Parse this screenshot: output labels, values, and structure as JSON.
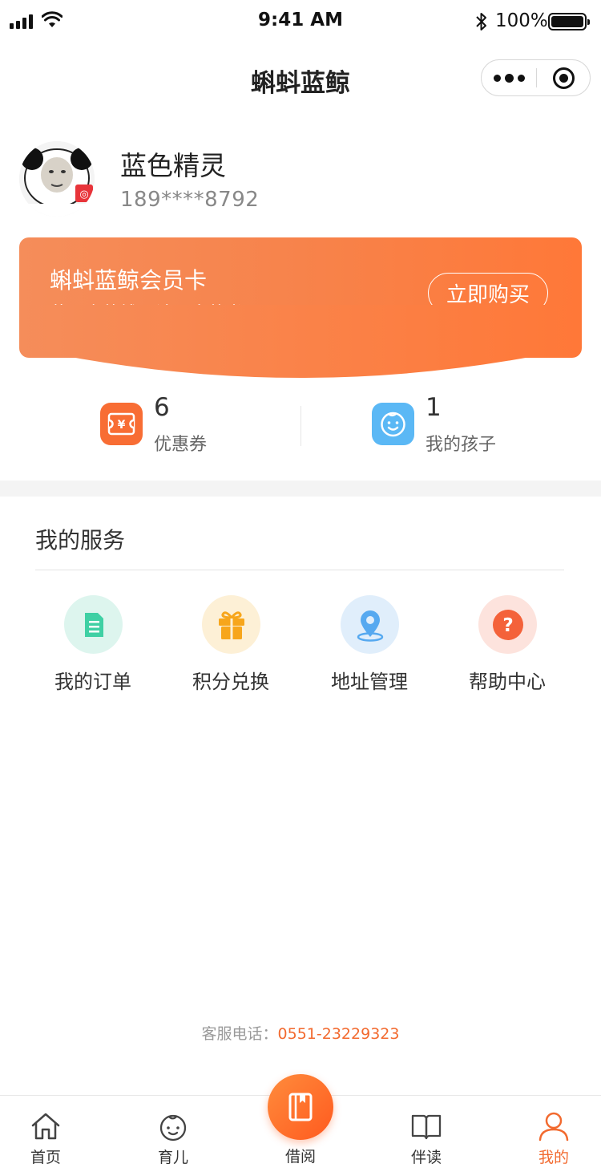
{
  "status_bar": {
    "time": "9:41 AM",
    "battery_percent": "100%"
  },
  "nav": {
    "title": "蝌蚪蓝鲸"
  },
  "profile": {
    "name": "蓝色精灵",
    "phone": "189****8792"
  },
  "member_card": {
    "title": "蝌蚪蓝鲸会员卡",
    "subtitle": "花更少的钱，读更多的书",
    "buy_label": "立即购买",
    "gradient_start": "#f58d5a",
    "gradient_end": "#ff7838"
  },
  "stats": [
    {
      "value": "6",
      "label": "优惠券",
      "icon": "coupon-icon",
      "color": "#f86d34"
    },
    {
      "value": "1",
      "label": "我的孩子",
      "icon": "child-face-icon",
      "color": "#5bb8f5"
    }
  ],
  "services": {
    "title": "我的服务",
    "items": [
      {
        "label": "我的订单",
        "icon": "order-document-icon",
        "bg": "#ddf5ee",
        "fg": "#3fd0a4"
      },
      {
        "label": "积分兑换",
        "icon": "gift-icon",
        "bg": "#fdf0d6",
        "fg": "#f7a61c"
      },
      {
        "label": "地址管理",
        "icon": "location-pin-icon",
        "bg": "#e0eefb",
        "fg": "#56a9f0"
      },
      {
        "label": "帮助中心",
        "icon": "help-question-icon",
        "bg": "#fde3dd",
        "fg": "#f4623a"
      }
    ]
  },
  "hotline": {
    "label": "客服电话：",
    "number": "0551-23229323"
  },
  "tabbar": {
    "items": [
      {
        "label": "首页",
        "icon": "home-icon"
      },
      {
        "label": "育儿",
        "icon": "baby-icon"
      },
      {
        "label": "借阅",
        "icon": "book-icon"
      },
      {
        "label": "伴读",
        "icon": "open-book-icon"
      },
      {
        "label": "我的",
        "icon": "user-icon"
      }
    ],
    "active_index": 4,
    "active_color": "#f26a2f"
  }
}
